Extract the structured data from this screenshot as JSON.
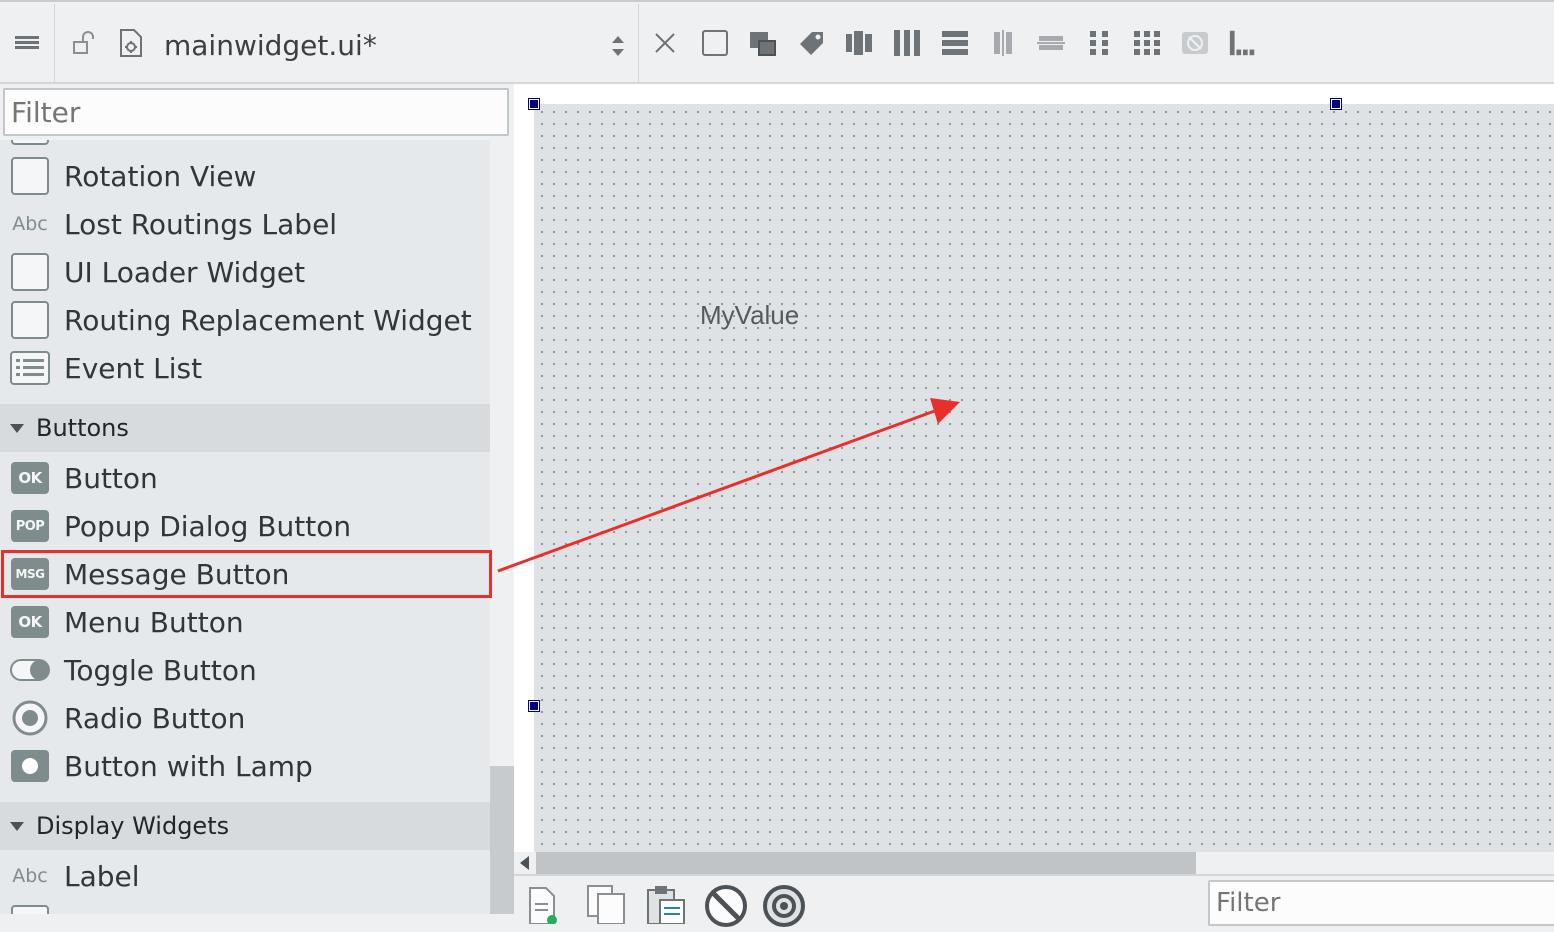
{
  "toolbar": {
    "document_title": "mainwidget.ui*",
    "icons": [
      "menu-icon",
      "lock-icon",
      "ui-file-icon",
      "updown-icon",
      "close-icon",
      "widget-mode-icon",
      "signal-slot-mode-icon",
      "buddy-mode-icon",
      "tab-order-mode-icon",
      "layout-horizontal-icon",
      "layout-vertical-icon",
      "layout-h-splitter-icon",
      "layout-v-splitter-icon",
      "layout-grid-icon",
      "layout-form-icon",
      "break-layout-icon",
      "adjust-size-icon"
    ]
  },
  "widgetbox": {
    "filter_placeholder": "Filter",
    "items_top": [
      {
        "label": "Rotation View",
        "icon": "widget-icon"
      },
      {
        "label": "Lost Routings Label",
        "icon": "label-abc-icon",
        "icon_text": "Abc"
      },
      {
        "label": "UI Loader Widget",
        "icon": "widget-icon"
      },
      {
        "label": "Routing Replacement Widget",
        "icon": "widget-icon"
      },
      {
        "label": "Event List",
        "icon": "list-icon"
      }
    ],
    "category_buttons": "Buttons",
    "buttons": [
      {
        "label": "Button",
        "icon": "ok-button-icon",
        "icon_text": "OK"
      },
      {
        "label": "Popup Dialog Button",
        "icon": "pop-button-icon",
        "icon_text": "POP"
      },
      {
        "label": "Message Button",
        "icon": "msg-button-icon",
        "icon_text": "MSG"
      },
      {
        "label": "Menu Button",
        "icon": "ok-button-icon",
        "icon_text": "OK"
      },
      {
        "label": "Toggle Button",
        "icon": "toggle-icon"
      },
      {
        "label": "Radio Button",
        "icon": "radio-icon"
      },
      {
        "label": "Button with Lamp",
        "icon": "lamp-button-icon"
      }
    ],
    "category_display": "Display Widgets",
    "display_items": [
      {
        "label": "Label",
        "icon": "label-abc-icon",
        "icon_text": "Abc"
      }
    ]
  },
  "form": {
    "label_text": "MyValue"
  },
  "bottom": {
    "filter_placeholder": "Filter",
    "icons": [
      "new-file-icon",
      "copy-icon",
      "paste-icon",
      "stop-icon",
      "settings-icon"
    ]
  },
  "colors": {
    "highlight": "#e8302a",
    "handle": "#000080",
    "form_background": "#dfe2e5"
  }
}
